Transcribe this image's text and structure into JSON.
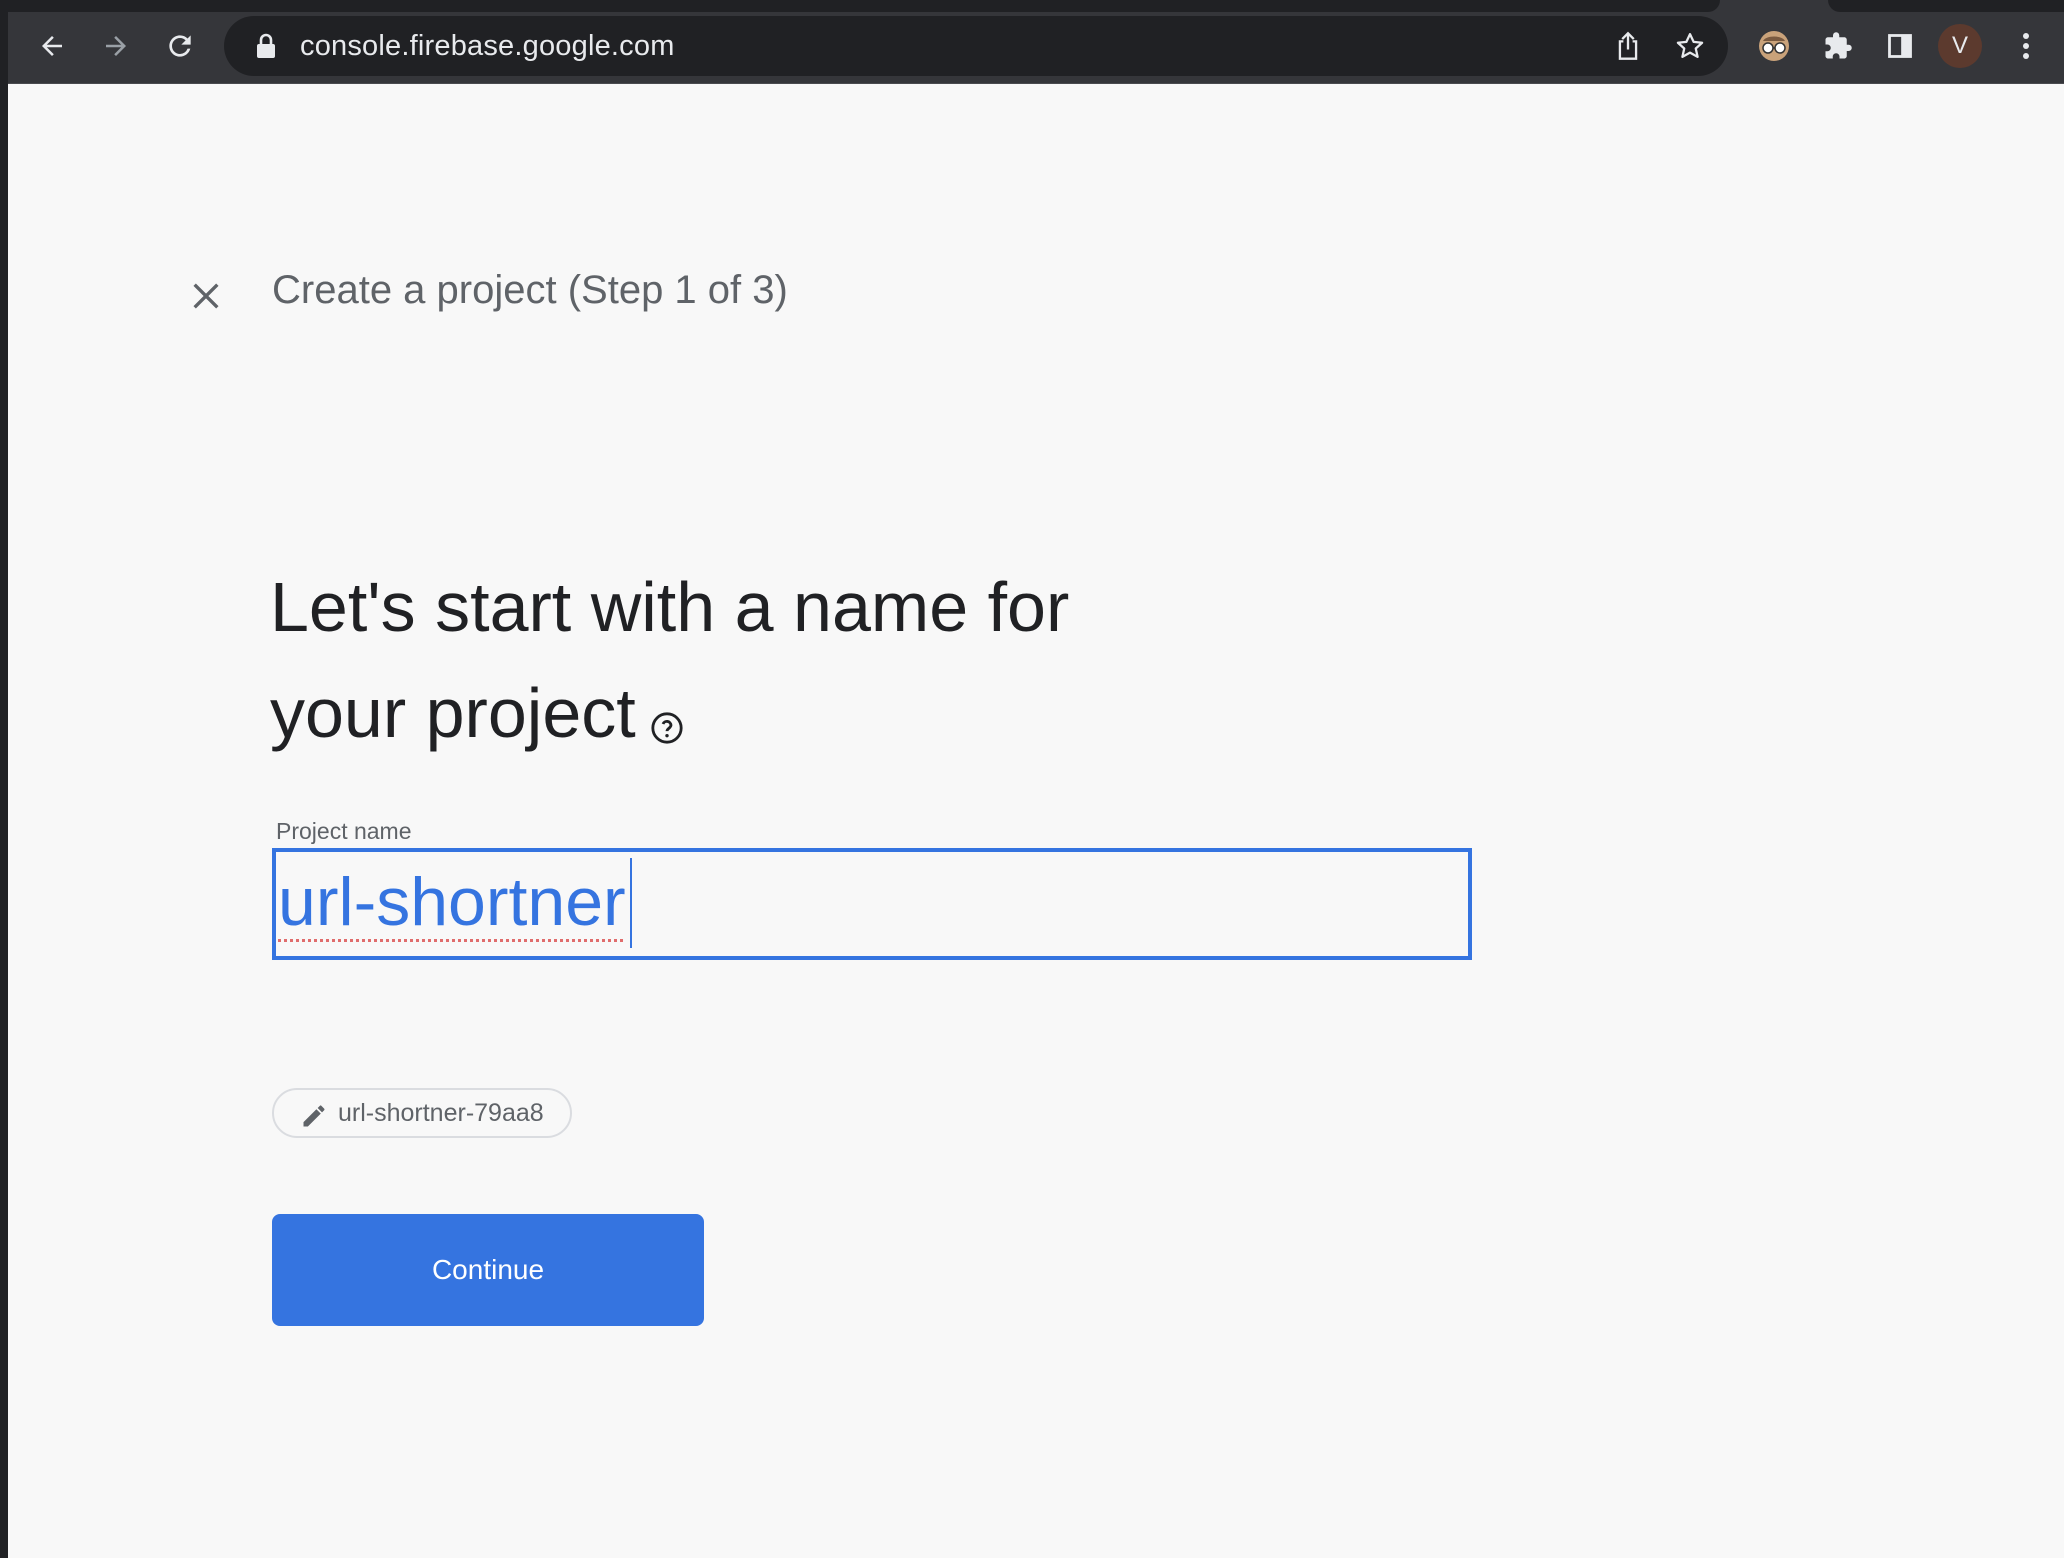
{
  "browser": {
    "url": "console.firebase.google.com",
    "profile_initial": "V"
  },
  "page": {
    "step_title": "Create a project (Step 1 of 3)",
    "heading_line1": "Let's start with a name for",
    "heading_line2": "your project",
    "field_label": "Project name",
    "project_name_value": "url-shortner",
    "project_id": "url-shortner-79aa8",
    "continue_label": "Continue"
  },
  "colors": {
    "accent": "#3574e0",
    "page_bg": "#f8f8f8",
    "toolbar_bg": "#35363a",
    "heading_text": "#202124",
    "secondary_text": "#5f6368"
  },
  "icons": {
    "toolbar": [
      "back-icon",
      "forward-icon",
      "reload-icon",
      "lock-icon",
      "share-icon",
      "bookmark-star-icon",
      "incognito-extension-icon",
      "extensions-puzzle-icon",
      "side-panel-icon",
      "profile-avatar",
      "more-menu-icon"
    ],
    "page": [
      "close-icon",
      "help-icon",
      "pencil-icon"
    ]
  }
}
